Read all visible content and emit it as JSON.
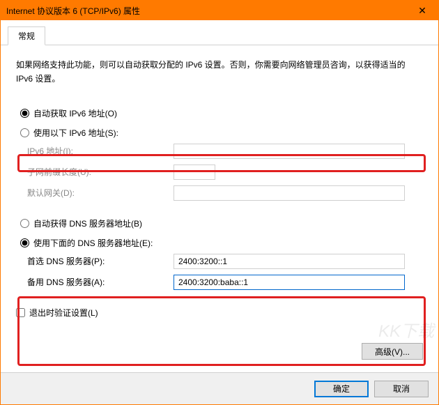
{
  "window": {
    "title": "Internet 协议版本 6 (TCP/IPv6) 属性",
    "close": "✕"
  },
  "tabs": {
    "general": "常规"
  },
  "description": "如果网络支持此功能，则可以自动获取分配的 IPv6 设置。否则，你需要向网络管理员咨询，以获得适当的 IPv6 设置。",
  "ip": {
    "auto_label": "自动获取 IPv6 地址(O)",
    "manual_label": "使用以下 IPv6 地址(S):",
    "address_label": "IPv6 地址(I):",
    "prefix_label": "子网前缀长度(U):",
    "gateway_label": "默认网关(D):",
    "address_value": "",
    "prefix_value": "",
    "gateway_value": ""
  },
  "dns": {
    "auto_label": "自动获得 DNS 服务器地址(B)",
    "manual_label": "使用下面的 DNS 服务器地址(E):",
    "preferred_label": "首选 DNS 服务器(P):",
    "alternate_label": "备用 DNS 服务器(A):",
    "preferred_value": "2400:3200::1",
    "alternate_value": "2400:3200:baba::1"
  },
  "validate_label": "退出时验证设置(L)",
  "advanced_label": "高级(V)...",
  "footer": {
    "ok": "确定",
    "cancel": "取消"
  },
  "watermark": "KK下载"
}
